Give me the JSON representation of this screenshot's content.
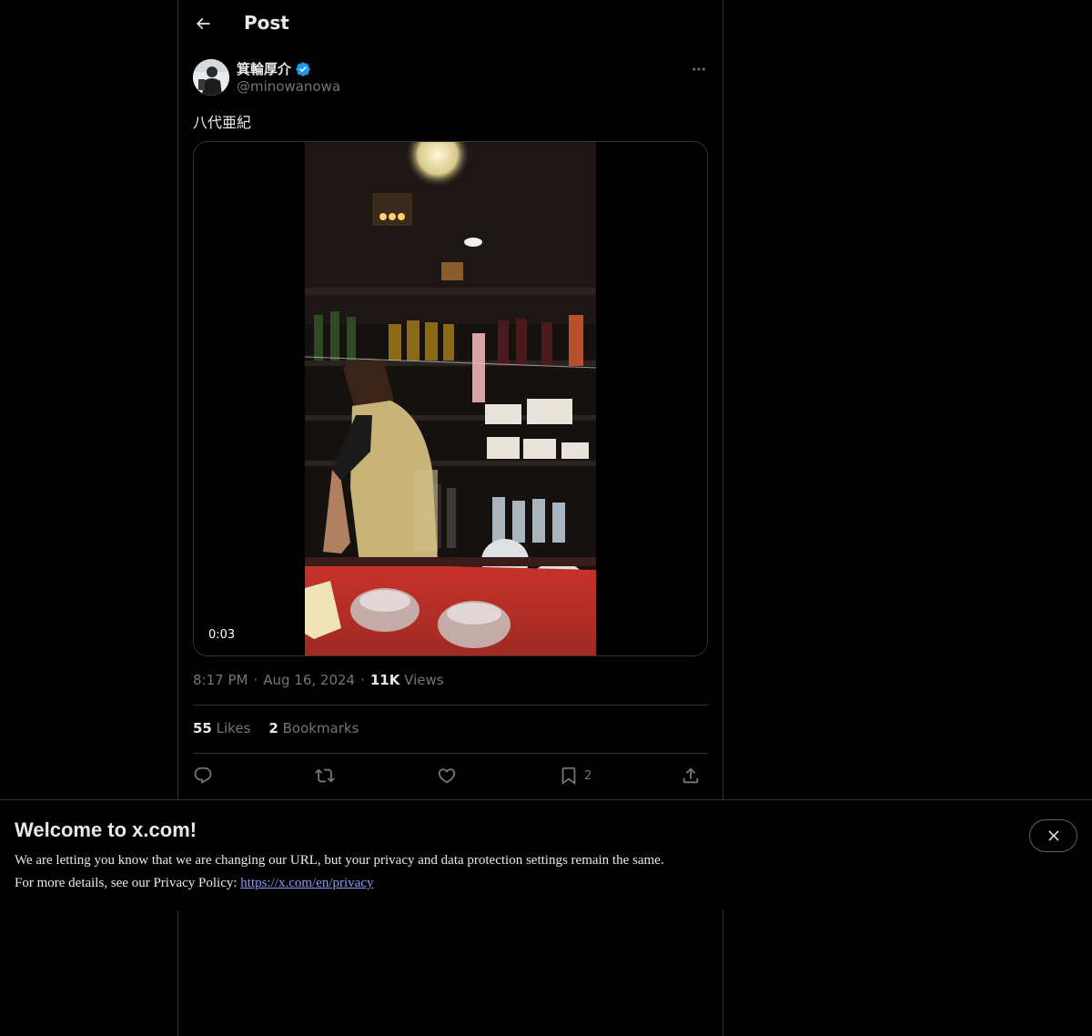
{
  "header": {
    "title": "Post"
  },
  "author": {
    "display_name": "箕輪厚介",
    "handle": "@minowanowa",
    "verified": true
  },
  "tweet": {
    "text": "八代亜紀"
  },
  "media": {
    "duration": "0:03"
  },
  "meta": {
    "time": "8:17 PM",
    "separator": "·",
    "date": "Aug 16, 2024",
    "views_count": "11K",
    "views_label": "Views"
  },
  "stats": {
    "likes_count": "55",
    "likes_label": "Likes",
    "bookmarks_count": "2",
    "bookmarks_label": "Bookmarks"
  },
  "actions": {
    "bookmark_count": "2"
  },
  "banner": {
    "title": "Welcome to x.com!",
    "line1": "We are letting you know that we are changing our URL, but your privacy and data protection settings remain the same.",
    "line2_prefix": "For more details, see our Privacy Policy: ",
    "link": "https://x.com/en/privacy"
  },
  "colors": {
    "background": "#000000",
    "border": "#2f3336",
    "muted": "#71767b",
    "verified": "#1d9bf0",
    "link": "#8b98f9"
  },
  "icons": [
    "back-arrow-icon",
    "verified-badge-icon",
    "more-icon",
    "reply-icon",
    "repost-icon",
    "like-icon",
    "bookmark-icon",
    "share-icon",
    "close-icon"
  ]
}
